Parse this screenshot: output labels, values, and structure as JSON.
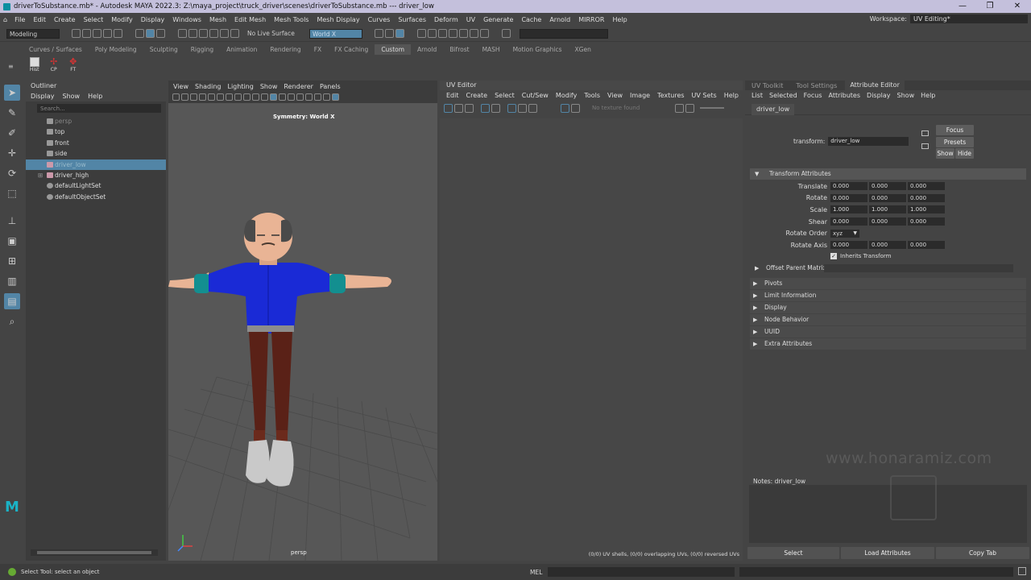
{
  "window": {
    "title": "driverToSubstance.mb* - Autodesk MAYA 2022.3: Z:\\maya_project\\truck_driver\\scenes\\driverToSubstance.mb  ---  driver_low",
    "controls": [
      "—",
      "❐",
      "✕"
    ]
  },
  "menubar": {
    "items": [
      "File",
      "Edit",
      "Create",
      "Select",
      "Modify",
      "Display",
      "Windows",
      "Mesh",
      "Edit Mesh",
      "Mesh Tools",
      "Mesh Display",
      "Curves",
      "Surfaces",
      "Deform",
      "UV",
      "Generate",
      "Cache",
      "Arnold",
      "MIRROR",
      "Help"
    ],
    "workspace_label": "Workspace:",
    "workspace_value": "UV Editing*"
  },
  "statusline": {
    "mode": "Modeling",
    "live_surface": "No Live Surface",
    "symmetry": "World X"
  },
  "shelf": {
    "tabs": [
      "Curves / Surfaces",
      "Poly Modeling",
      "Sculpting",
      "Rigging",
      "Animation",
      "Rendering",
      "FX",
      "FX Caching",
      "Custom",
      "Arnold",
      "Bifrost",
      "MASH",
      "Motion Graphics",
      "XGen"
    ],
    "active_tab": "Custom",
    "icons": [
      "Hist",
      "CP",
      "FT"
    ]
  },
  "outliner": {
    "title": "Outliner",
    "menus": [
      "Display",
      "Show",
      "Help"
    ],
    "search_placeholder": "Search...",
    "items": [
      {
        "label": "persp"
      },
      {
        "label": "top"
      },
      {
        "label": "front"
      },
      {
        "label": "side"
      },
      {
        "label": "driver_low"
      },
      {
        "label": "driver_high"
      },
      {
        "label": "defaultLightSet"
      },
      {
        "label": "defaultObjectSet"
      }
    ]
  },
  "viewport": {
    "menus": [
      "View",
      "Shading",
      "Lighting",
      "Show",
      "Renderer",
      "Panels"
    ],
    "symmetry_label": "Symmetry: World X",
    "camera": "persp"
  },
  "uv_editor": {
    "title": "UV Editor",
    "menus": [
      "Edit",
      "Create",
      "Select",
      "Cut/Sew",
      "Modify",
      "Tools",
      "View",
      "Image",
      "Textures",
      "UV Sets",
      "Help"
    ],
    "texture_status": "No texture found",
    "footer": "(0/0) UV shells, (0/0) overlapping UVs, (0/0) reversed UVs"
  },
  "attribute_editor": {
    "tabs": [
      "UV Toolkit",
      "Tool Settings",
      "Attribute Editor"
    ],
    "active_tab": "Attribute Editor",
    "menus": [
      "List",
      "Selected",
      "Focus",
      "Attributes",
      "Display",
      "Show",
      "Help"
    ],
    "node_tab": "driver_low",
    "transform_label": "transform:",
    "transform_value": "driver_low",
    "buttons": {
      "focus": "Focus",
      "presets": "Presets",
      "show": "Show",
      "hide": "Hide"
    },
    "section_title": "Transform Attributes",
    "rows": [
      {
        "label": "Translate",
        "values": [
          "0.000",
          "0.000",
          "0.000"
        ]
      },
      {
        "label": "Rotate",
        "values": [
          "0.000",
          "0.000",
          "0.000"
        ]
      },
      {
        "label": "Scale",
        "values": [
          "1.000",
          "1.000",
          "1.000"
        ]
      },
      {
        "label": "Shear",
        "values": [
          "0.000",
          "0.000",
          "0.000"
        ]
      }
    ],
    "rotate_order_label": "Rotate Order",
    "rotate_order_value": "xyz",
    "rotate_axis": {
      "label": "Rotate Axis",
      "values": [
        "0.000",
        "0.000",
        "0.000"
      ]
    },
    "inherits": "Inherits Transform",
    "offset_parent": "Offset Parent Matrix",
    "sections": [
      "Pivots",
      "Limit Information",
      "Display",
      "Node Behavior",
      "UUID",
      "Extra Attributes"
    ],
    "notes_label": "Notes:  driver_low",
    "bottom_buttons": [
      "Select",
      "Load Attributes",
      "Copy Tab"
    ]
  },
  "watermark": "www.honaramiz.com",
  "statusbar": {
    "help_text": "Select Tool: select an object",
    "cmd_lang": "MEL"
  },
  "colors": {
    "selection": "#5285a6",
    "shirt": "#1a2ad6",
    "pants": "#5a2117",
    "skin": "#e9b495"
  }
}
